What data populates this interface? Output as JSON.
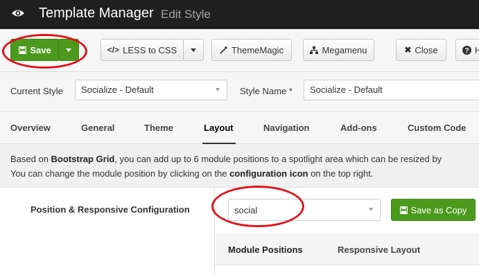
{
  "header": {
    "title": "Template Manager",
    "subtitle": "Edit Style"
  },
  "toolbar": {
    "save_label": "Save",
    "less_label": "LESS to CSS",
    "less_icon": "</>",
    "thememagic_label": "ThemeMagic",
    "megamenu_label": "Megamenu",
    "close_label": "Close",
    "help_label": "H"
  },
  "style_row": {
    "current_style_label": "Current Style",
    "current_style_value": "Socialize - Default",
    "style_name_label": "Style Name *",
    "style_name_value": "Socialize - Default"
  },
  "tabs": [
    "Overview",
    "General",
    "Theme",
    "Layout",
    "Navigation",
    "Add-ons",
    "Custom Code"
  ],
  "active_tab": "Layout",
  "info": {
    "l1_pre": "Based on ",
    "l1_bold": "Bootstrap Grid",
    "l1_post": ", you can add up to 6 module positions to a spotlight area which can be resized by",
    "l2_pre": "You can change the module position by clicking on the ",
    "l2_bold": "configuration icon",
    "l2_post": " on the top right."
  },
  "config": {
    "label": "Position & Responsive Configuration",
    "position_value": "social",
    "save_copy_label": "Save as Copy"
  },
  "sub_tabs": [
    "Module Positions",
    "Responsive Layout"
  ],
  "active_sub_tab": "Module Positions",
  "colors": {
    "header_bg": "#1f1f1f",
    "accent_green": "#4c9a1d",
    "annotation_red": "#e3111b"
  }
}
